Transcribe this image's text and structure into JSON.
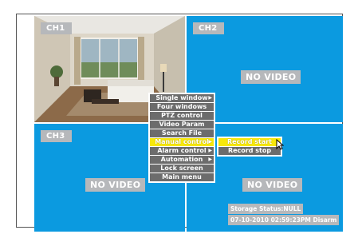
{
  "channels": {
    "ch1": {
      "label": "CH1"
    },
    "ch2": {
      "label": "CH2",
      "status": "NO VIDEO"
    },
    "ch3": {
      "label": "CH3",
      "status": "NO VIDEO"
    },
    "ch4": {
      "status": "NO VIDEO"
    }
  },
  "menu": {
    "items": [
      {
        "label": "Single window",
        "has_submenu": true
      },
      {
        "label": "Four windows"
      },
      {
        "label": "PTZ control"
      },
      {
        "label": "Video Param"
      },
      {
        "label": "Search File"
      },
      {
        "label": "Manual control",
        "has_submenu": true,
        "selected": true
      },
      {
        "label": "Alarm control",
        "has_submenu": true
      },
      {
        "label": "Automation",
        "has_submenu": true
      },
      {
        "label": "Lock screen"
      },
      {
        "label": "Main menu"
      }
    ]
  },
  "submenu": {
    "items": [
      {
        "label": "Record start",
        "selected": true
      },
      {
        "label": "Record stop"
      }
    ]
  },
  "status": {
    "storage": "Storage Status:NULL",
    "datetime": "07-10-2010 02:59:23PM Disarm"
  },
  "colors": {
    "channel_bg": "#0b9ae0",
    "label_bg": "#b6b8bb",
    "menu_item_bg": "#6c6c6c",
    "menu_selected_bg": "#f7e80a"
  }
}
